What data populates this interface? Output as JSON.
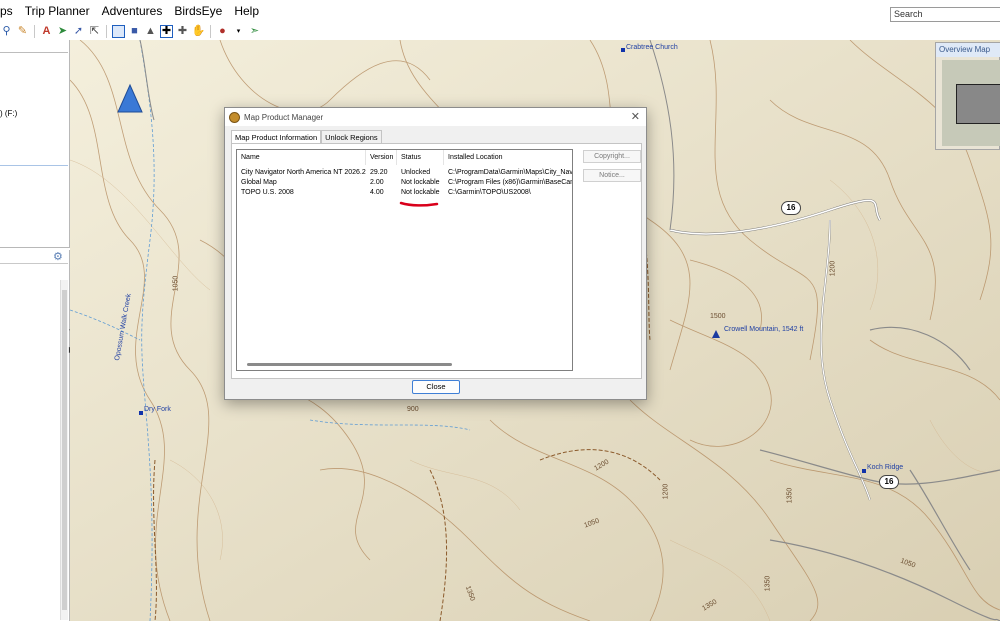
{
  "menu": [
    "ps",
    "Trip Planner",
    "Adventures",
    "BirdsEye",
    "Help"
  ],
  "search": {
    "value": "Search"
  },
  "left_panel": {
    "drive_label": ") (F:)"
  },
  "overview": {
    "title": "Overview Map"
  },
  "map": {
    "poi_labels": [
      "Crabtree Church",
      "Crowell Mountain, 1542 ft",
      "Koch Ridge",
      "Dry Fork"
    ],
    "stream_label": "Opossum Walk Creek",
    "route_shields": [
      "16",
      "16"
    ],
    "contour_labels": [
      "1050",
      "900",
      "1200",
      "1500",
      "1200",
      "1350",
      "1050",
      "1350",
      "1050",
      "1200",
      "1350",
      "1350"
    ]
  },
  "dialog": {
    "title": "Map Product Manager",
    "tabs": [
      "Map Product Information",
      "Unlock Regions"
    ],
    "columns": [
      "Name",
      "Version",
      "Status",
      "Installed Location"
    ],
    "rows": [
      {
        "name": "City Navigator North America NT 2026.2",
        "version": "29.20",
        "status": "Unlocked",
        "location": "C:\\ProgramData\\Garmin\\Maps\\City_Nav"
      },
      {
        "name": "Global Map",
        "version": "2.00",
        "status": "Not lockable",
        "location": "C:\\Program Files (x86)\\Garmin\\BaseCam"
      },
      {
        "name": "TOPO U.S. 2008",
        "version": "4.00",
        "status": "Not lockable",
        "location": "C:\\Garmin\\TOPO\\US2008\\"
      }
    ],
    "buttons": {
      "copyright": "Copyright...",
      "notice": "Notice...",
      "close": "Close"
    },
    "annotation_color": "#d9001b"
  }
}
